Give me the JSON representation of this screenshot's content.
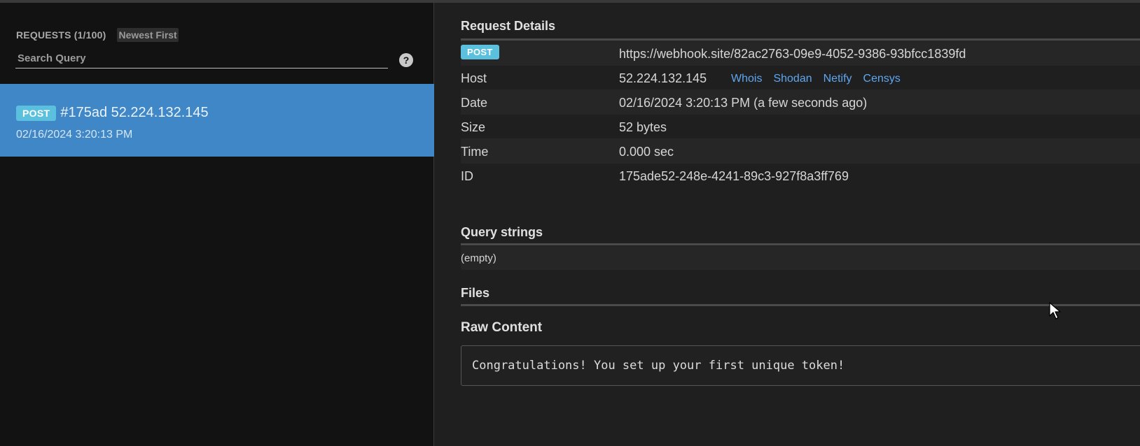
{
  "sidebar": {
    "requests_label": "REQUESTS (1/100)",
    "sort_label": "Newest First",
    "search_placeholder": "Search Query",
    "help_label": "?",
    "items": [
      {
        "method": "POST",
        "title": "#175ad 52.224.132.145",
        "date": "02/16/2024 3:20:13 PM"
      }
    ]
  },
  "details": {
    "title": "Request Details",
    "method": "POST",
    "url": "https://webhook.site/82ac2763-09e9-4052-9386-93bfcc1839fd",
    "host_label": "Host",
    "host_value": "52.224.132.145",
    "host_links": [
      "Whois",
      "Shodan",
      "Netify",
      "Censys"
    ],
    "date_label": "Date",
    "date_value": "02/16/2024 3:20:13 PM (a few seconds ago)",
    "size_label": "Size",
    "size_value": "52 bytes",
    "time_label": "Time",
    "time_value": "0.000 sec",
    "id_label": "ID",
    "id_value": "175ade52-248e-4241-89c3-927f8a3ff769"
  },
  "query": {
    "title": "Query strings",
    "empty": "(empty)"
  },
  "files": {
    "title": "Files"
  },
  "raw": {
    "title": "Raw Content",
    "content": "Congratulations! You set up your first unique token!"
  },
  "colors": {
    "selected_item": "#3f87c7",
    "badge": "#5bc0de",
    "link": "#5ea7f0"
  }
}
